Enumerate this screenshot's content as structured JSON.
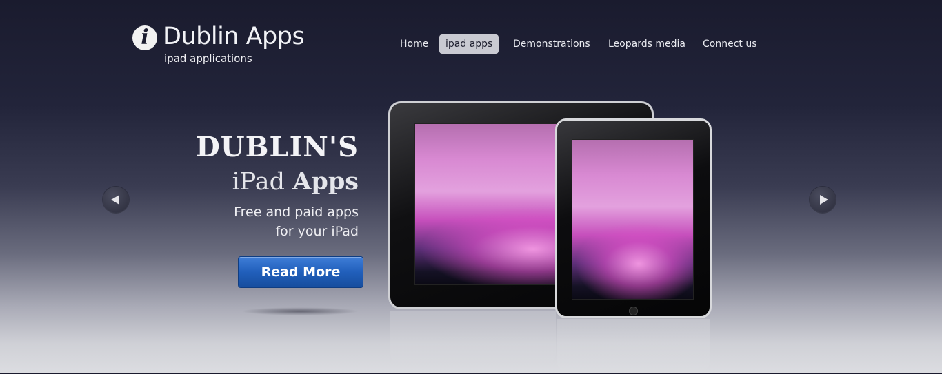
{
  "header": {
    "logo_mark": "i",
    "title": "Dublin Apps",
    "subtitle": "ipad applications"
  },
  "nav": {
    "items": [
      {
        "label": "Home",
        "active": false
      },
      {
        "label": "ipad apps",
        "active": true
      },
      {
        "label": "Demonstrations",
        "active": false
      },
      {
        "label": "Leopards media",
        "active": false
      },
      {
        "label": "Connect us",
        "active": false
      }
    ]
  },
  "hero": {
    "headline": "DUBLIN'S",
    "subheadline_light": "iPad",
    "subheadline_bold": "Apps",
    "line1": "Free and paid apps",
    "line2": "for your iPad",
    "button_label": "Read More"
  },
  "carousel": {
    "prev_icon": "arrow-left-icon",
    "next_icon": "arrow-right-icon"
  },
  "colors": {
    "background_top": "#1a1b2e",
    "background_bottom": "#dcdde1",
    "button_blue": "#215fbb",
    "nav_active_bg": "#c9cad2"
  }
}
